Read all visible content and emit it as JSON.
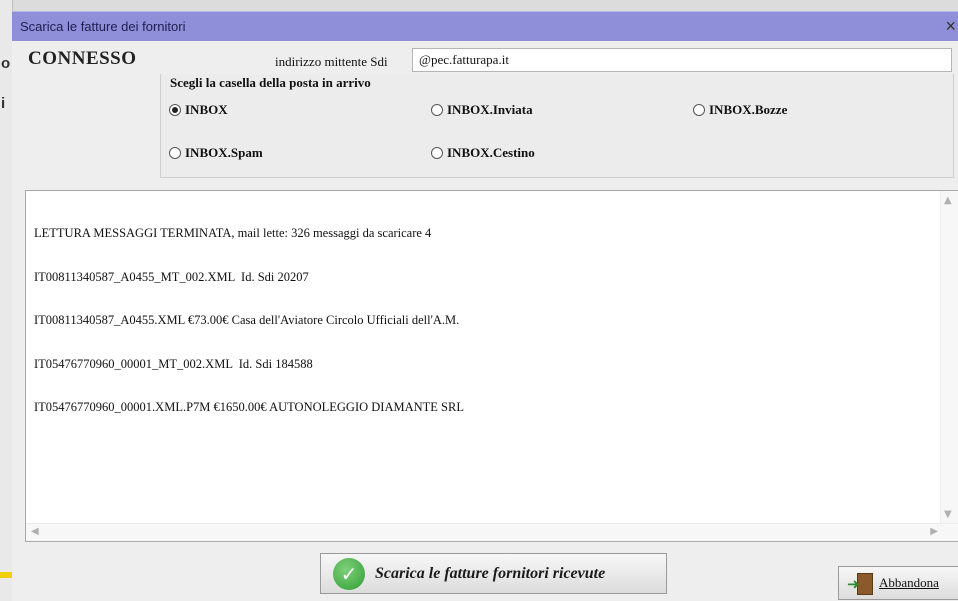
{
  "window": {
    "title": "Scarica le fatture dei fornitori",
    "close_glyph": "×"
  },
  "connection": {
    "status": "CONNESSO"
  },
  "sender": {
    "label": "indirizzo mittente Sdi",
    "value": "@pec.fatturapa.it"
  },
  "mailbox": {
    "title": "Scegli la casella della posta in arrivo",
    "options": [
      {
        "label": "INBOX",
        "selected": true
      },
      {
        "label": "INBOX.Inviata",
        "selected": false
      },
      {
        "label": "INBOX.Bozze",
        "selected": false
      },
      {
        "label": "INBOX.Spam",
        "selected": false
      },
      {
        "label": "INBOX.Cestino",
        "selected": false
      }
    ]
  },
  "log": {
    "lines": [
      "LETTURA MESSAGGI TERMINATA, mail lette: 326 messaggi da scaricare 4",
      "IT00811340587_A0455_MT_002.XML  Id. Sdi 20207",
      "IT00811340587_A0455.XML €73.00€ Casa dell'Aviatore Circolo Ufficiali dell'A.M.",
      "IT05476770960_00001_MT_002.XML  Id. Sdi 184588",
      "IT05476770960_00001.XML.P7M €1650.00€ AUTONOLEGGIO DIAMANTE SRL"
    ]
  },
  "actions": {
    "download_label": "Scarica le fatture fornitori ricevute",
    "abandon_label": "Abbandona"
  },
  "icons": {
    "download": "check-icon",
    "abandon": "exit-door-icon"
  },
  "colors": {
    "titlebar": "#8f8fd9",
    "check_green": "#2f9d33"
  }
}
